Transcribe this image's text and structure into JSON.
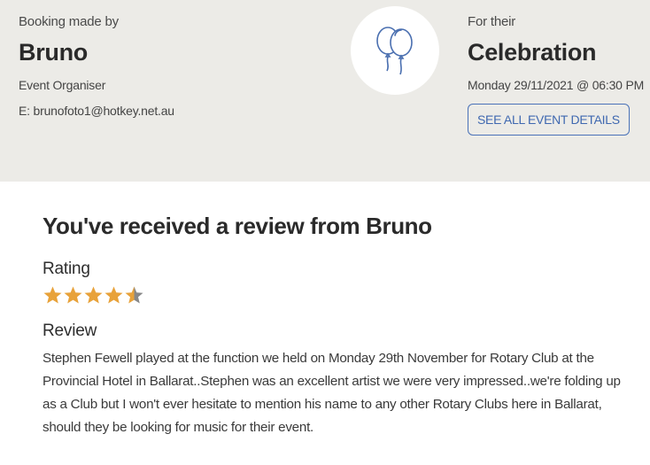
{
  "booking": {
    "made_by_label": "Booking made by",
    "name": "Bruno",
    "role": "Event Organiser",
    "email": "E: brunofoto1@hotkey.net.au"
  },
  "event": {
    "for_label": "For their",
    "type": "Celebration",
    "datetime": "Monday 29/11/2021 @ 06:30 PM",
    "details_button": "SEE ALL EVENT DETAILS",
    "icon": "balloons-icon"
  },
  "review": {
    "title": "You've received a review from Bruno",
    "rating_label": "Rating",
    "rating": 4.5,
    "rating_max": 5,
    "review_label": "Review",
    "text": "Stephen Fewell played at the function we held on Monday 29th November for Rotary Club at the Provincial Hotel in Ballarat..Stephen was an excellent artist we were very impressed..we're folding up as a Club but I won't ever hesitate to mention his name to any other Rotary Clubs here in Ballarat, should they be looking for music for their event."
  },
  "colors": {
    "header_bg": "#ecebe7",
    "accent_blue": "#3f68b0",
    "star_filled": "#e8a23a",
    "star_empty": "#888888"
  }
}
